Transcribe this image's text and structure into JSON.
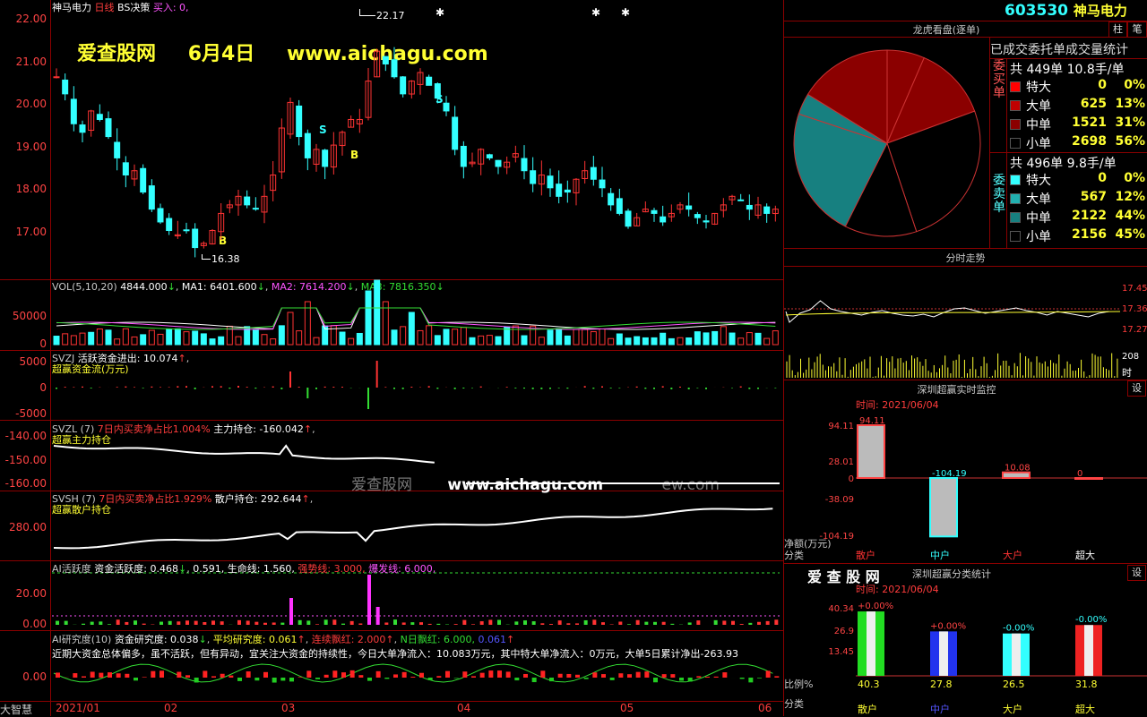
{
  "app": {
    "name": "大智慧"
  },
  "stock": {
    "code": "603530",
    "name": "神马电力"
  },
  "chart_header": {
    "name": "神马电力",
    "period": "日线",
    "strategy": "BS决策",
    "buy": "买入: 0,"
  },
  "watermark": {
    "site": "爱查股网",
    "date": "6月4日",
    "url": "www.aichagu.com",
    "center": "爱查股网",
    "center_url": "www.aichagu.com",
    "center_tail": "ew.com"
  },
  "kline": {
    "max_label": "22.17",
    "min_label": "16.38",
    "y_ticks": [
      "22.00",
      "21.00",
      "20.00",
      "19.00",
      "18.00",
      "17.00"
    ],
    "markers": [
      "S",
      "S",
      "B",
      "B"
    ]
  },
  "x_axis": {
    "labels": [
      "2021/01",
      "02",
      "03",
      "04",
      "05",
      "06"
    ]
  },
  "vol": {
    "title": "VOL(5,10,20)",
    "v": "4844.000",
    "ma1": "MA1: 6401.600",
    "ma2": "MA2: 7614.200",
    "ma3": "MA3: 7816.350",
    "ticks": [
      "50000",
      "0"
    ]
  },
  "svzj": {
    "title": "SVZJ",
    "label": "活跃资金进出:",
    "value": "10.074",
    "sub": "超赢资金流(万元)",
    "ticks": [
      "5000",
      "0",
      "-5000"
    ]
  },
  "svzl": {
    "title": "SVZL (7)",
    "ratio": "7日内买卖净占比1.004%",
    "label": "主力持仓:",
    "value": "-160.042",
    "sub": "超赢主力持仓",
    "ticks": [
      "-140.00",
      "-150.00",
      "-160.00"
    ]
  },
  "svsh": {
    "title": "SVSH (7)",
    "ratio": "7日内买卖净占比1.929%",
    "label": "散户持仓:",
    "value": "292.644",
    "sub": "超赢散户持仓",
    "ticks": [
      "280.00"
    ]
  },
  "ai_active": {
    "title": "AI活跃度",
    "a": "资金活跃度: 0.468",
    "b": "0.591,",
    "c": "生命线: 1.560,",
    "d": "强势线: 3.000,",
    "e": "爆发线: 6.000,",
    "ticks": [
      "20.00",
      "0.00"
    ]
  },
  "ai_research": {
    "title": "AI研究度(10)",
    "a": "资金研究度: 0.038",
    "b": "平均研究度: 0.061",
    "c": "连续飘红: 2.000",
    "d": "N日飘红: 6.000,",
    "e": "0.061",
    "comment": "近期大资金总体偏多，虽不活跃，但有异动，宜关注大资金的持续性，今日大单净流入：10.083万元，其中特大单净流入：0万元，大单5日累计净出-263.93",
    "ticks": [
      "0.00"
    ]
  },
  "right": {
    "btn1": "柱",
    "btn2": "笔",
    "dragon_title": "龙虎看盘(逐单)",
    "stat_title": "已成交委托单成交量统计",
    "buy": {
      "side": "委买单",
      "total": "共 449单 10.8手/单",
      "rows": [
        {
          "label": "特大",
          "n": "0",
          "p": "0%",
          "color": "#ff0000"
        },
        {
          "label": "大单",
          "n": "625",
          "p": "13%",
          "color": "#c00000"
        },
        {
          "label": "中单",
          "n": "1521",
          "p": "31%",
          "color": "#8b0000"
        },
        {
          "label": "小单",
          "n": "2698",
          "p": "56%",
          "color": "#000000"
        }
      ]
    },
    "sell": {
      "side": "委卖单",
      "total": "共 496单 9.8手/单",
      "rows": [
        {
          "label": "特大",
          "n": "0",
          "p": "0%",
          "color": "#33ffff"
        },
        {
          "label": "大单",
          "n": "567",
          "p": "12%",
          "color": "#21b0b0"
        },
        {
          "label": "中单",
          "n": "2122",
          "p": "44%",
          "color": "#178080"
        },
        {
          "label": "小单",
          "n": "2156",
          "p": "45%",
          "color": "#000000"
        }
      ]
    },
    "pie": {
      "slices": [
        6.5,
        12.9,
        25.5,
        12.5,
        22.7,
        3.7,
        16.2
      ]
    },
    "intraday": {
      "title": "分时走势",
      "ticks": [
        "17.45",
        "17.36",
        "17.27"
      ],
      "vol": "208",
      "vol_unit": "时"
    },
    "monitor": {
      "title": "深圳超赢实时监控",
      "setbtn": "设",
      "time": "时间: 2021/06/04",
      "ticks": [
        "94.11",
        "28.01",
        "0",
        "-38.09",
        "-104.19"
      ],
      "unit": "净额(万元)",
      "cat": "分类",
      "bars": [
        {
          "label": "散户",
          "value": 94.11,
          "text": "94.11"
        },
        {
          "label": "中户",
          "value": -104.19,
          "text": "-104.19"
        },
        {
          "label": "大户",
          "value": 10.08,
          "text": "10.08"
        },
        {
          "label": "超大",
          "value": 0,
          "text": "0"
        }
      ]
    },
    "classify": {
      "logo": "爱 查 股 网",
      "title": "深圳超赢分类统计",
      "setbtn": "设",
      "time": "时间: 2021/06/04",
      "ticks": [
        "40.34",
        "26.9",
        "13.45"
      ],
      "ratio": "比例%",
      "cat": "分类",
      "bars": [
        {
          "label": "散户",
          "value": 40.3,
          "chg": "+0.00%",
          "text": "40.3",
          "color": "#22dd22"
        },
        {
          "label": "中户",
          "value": 27.8,
          "chg": "+0.00%",
          "text": "27.8",
          "color": "#2233ee"
        },
        {
          "label": "大户",
          "value": 26.5,
          "text": "26.5",
          "chg": "-0.00%",
          "color": "#33ffff"
        },
        {
          "label": "超大",
          "value": 31.8,
          "chg": "-0.00%",
          "text": "31.8",
          "color": "#ee2222"
        }
      ]
    }
  }
}
